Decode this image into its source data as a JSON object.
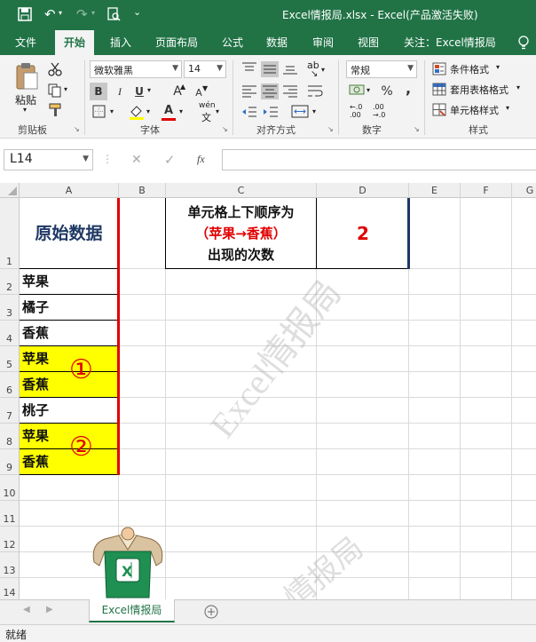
{
  "window": {
    "title": "Excel情报局.xlsx  -  Excel(产品激活失败)"
  },
  "ribbon_tabs": [
    "文件",
    "开始",
    "插入",
    "页面布局",
    "公式",
    "数据",
    "审阅",
    "视图",
    "关注：Excel情报局"
  ],
  "ribbon": {
    "clipboard": {
      "paste_label": "粘贴",
      "group_label": "剪贴板"
    },
    "font": {
      "font_name": "微软雅黑",
      "font_size": "14",
      "bold": "B",
      "italic": "I",
      "underline": "U",
      "grow": "A",
      "shrink": "A",
      "font_color": "A",
      "phonetic": "wén",
      "group_label": "字体"
    },
    "alignment": {
      "group_label": "对齐方式"
    },
    "number": {
      "format": "常规",
      "percent": "%",
      "comma": ",",
      "inc_decimal": "←.0\n.00",
      "dec_decimal": ".00\n→.0",
      "group_label": "数字"
    },
    "styles": {
      "conditional": "条件格式",
      "table_format": "套用表格格式",
      "cell_styles": "单元格样式",
      "group_label": "样式"
    }
  },
  "formula_bar": {
    "name_box": "L14",
    "fx": "fx",
    "cancel": "✕",
    "confirm": "✓"
  },
  "columns": [
    "A",
    "B",
    "C",
    "D",
    "E",
    "F",
    "G"
  ],
  "rows": [
    "1",
    "2",
    "3",
    "4",
    "5",
    "6",
    "7",
    "8",
    "9",
    "10",
    "11",
    "12",
    "13",
    "14"
  ],
  "cells": {
    "A1": "原始数据",
    "A2": "苹果",
    "A3": "橘子",
    "A4": "香蕉",
    "A5": "苹果",
    "A6": "香蕉",
    "A7": "桃子",
    "A8": "苹果",
    "A9": "香蕉",
    "C1_line1": "单元格上下顺序为",
    "C1_line2": "（苹果→香蕉）",
    "C1_line3": "出现的次数",
    "D1": "2"
  },
  "annotations": {
    "circle1": "①",
    "circle2": "②"
  },
  "watermark": {
    "text": "Excel情报局",
    "lower_text": "情报局"
  },
  "sheet_tabs": [
    "Excel情报局"
  ],
  "status": {
    "ready": "就绪"
  },
  "colors": {
    "excel_green": "#217346",
    "highlight_yellow": "#FFFF00",
    "accent_red": "#E00000",
    "title_navy": "#1F3864"
  }
}
